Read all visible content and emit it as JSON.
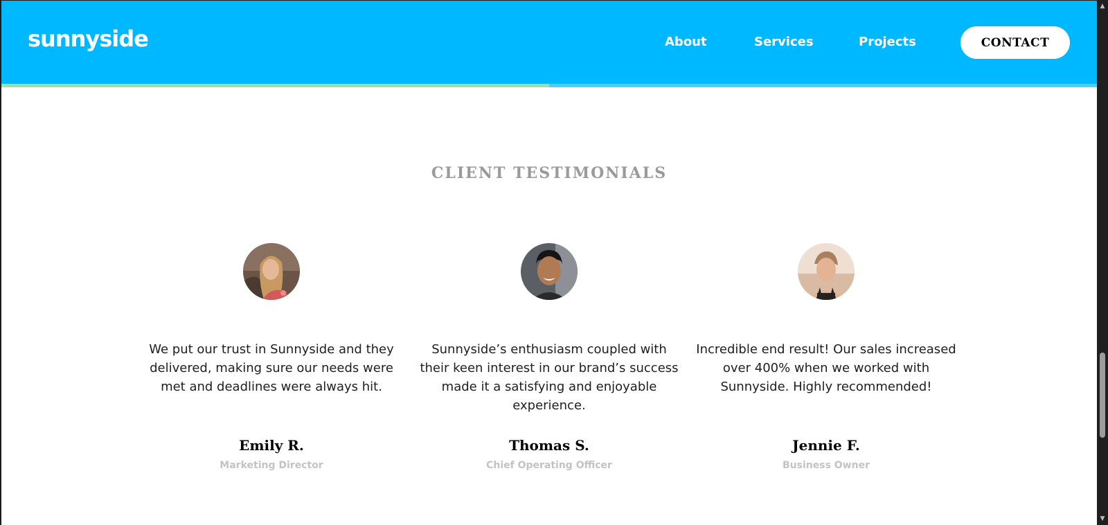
{
  "header": {
    "logo": "sunnyside",
    "nav": {
      "about": "About",
      "services": "Services",
      "projects": "Projects"
    },
    "contact_label": "CONTACT",
    "scroll_progress": 0.5
  },
  "section": {
    "title": "CLIENT TESTIMONIALS",
    "testimonials": [
      {
        "quote": "We put our trust in Sunnyside and they delivered, making sure our needs were met and deadlines were always hit.",
        "name": "Emily R.",
        "role": "Marketing Director"
      },
      {
        "quote": "Sunnyside’s enthusiasm coupled with their keen interest in our brand’s success made it a satisfying and enjoyable experience.",
        "name": "Thomas S.",
        "role": "Chief Operating Officer"
      },
      {
        "quote": "Incredible end result! Our sales increased over 400% when we worked with Sunnyside. Highly recommended!",
        "name": "Jennie F.",
        "role": "Business Owner"
      }
    ]
  },
  "scrollbar": {
    "position": 0.82,
    "thumb_fraction": 0.17
  },
  "colors": {
    "header_bg": "#00b8ff",
    "progress_green": "#9ee0a8",
    "progress_track": "#4fcdfd",
    "title_gray": "#9a9a9a",
    "role_gray": "#c3c3c3"
  },
  "icons": {
    "scroll_up": "chevron-up-icon",
    "scroll_down": "chevron-down-icon"
  }
}
